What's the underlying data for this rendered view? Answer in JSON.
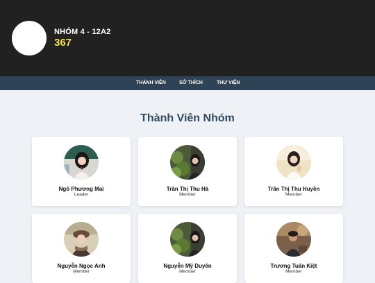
{
  "header": {
    "group_name": "NHÓM 4 - 12A2",
    "count": "367"
  },
  "nav": {
    "items": [
      "THÀNH VIÊN",
      "SỞ THÍCH",
      "THƯ VIỆN"
    ]
  },
  "section": {
    "title": "Thành Viên Nhóm"
  },
  "members": [
    {
      "name": "Ngô Phương Mai",
      "role": "Leader"
    },
    {
      "name": "Trần Thị Thu Hà",
      "role": "Member"
    },
    {
      "name": "Trần Thị Thu Huyền",
      "role": "Member"
    },
    {
      "name": "Nguyễn Ngọc Anh",
      "role": "Member"
    },
    {
      "name": "Nguyễn Mỹ Duyên",
      "role": "Member"
    },
    {
      "name": "Trương Tuấn Kiệt",
      "role": "Member"
    }
  ],
  "colors": {
    "header_bg": "#212121",
    "nav_bg": "#2f4357",
    "count_accent": "#f5e04a",
    "page_bg": "#eef1f6"
  }
}
